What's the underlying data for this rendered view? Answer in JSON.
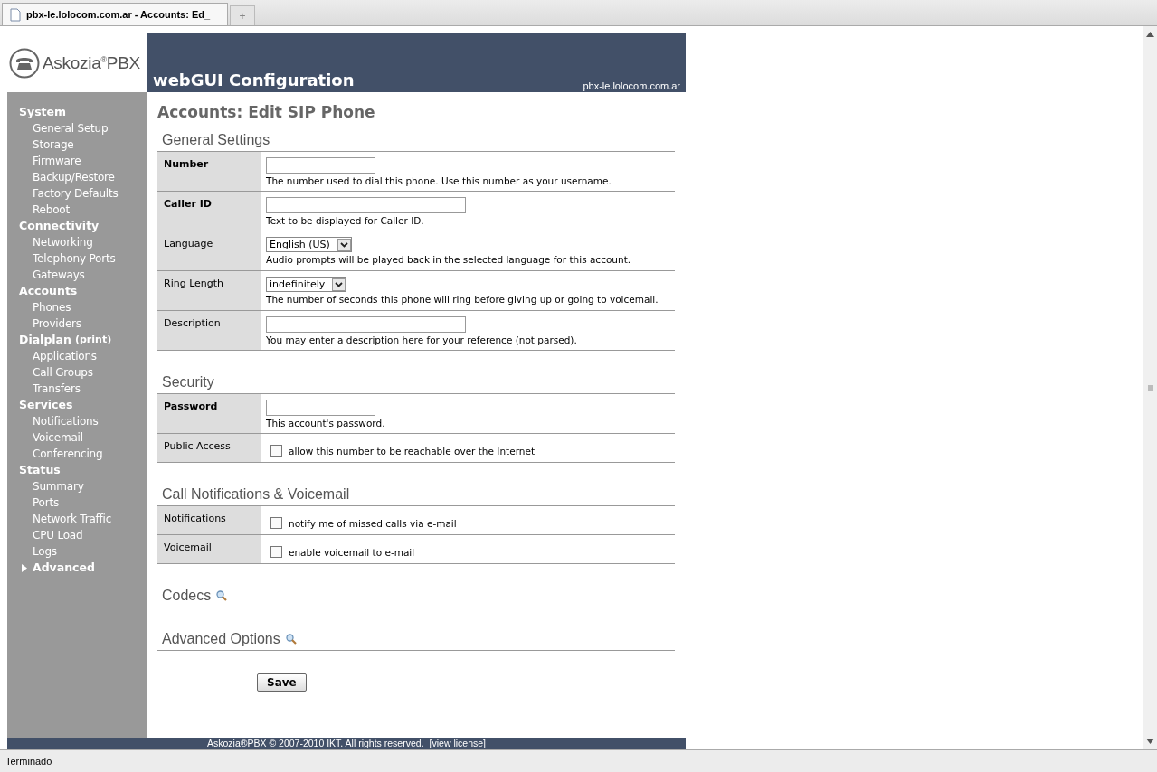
{
  "browser": {
    "tab_title": "pbx-le.lolocom.com.ar - Accounts: Ed_",
    "new_tab": "+",
    "status_text": "Terminado"
  },
  "header": {
    "logo_name": "Askozia",
    "logo_mark": "®",
    "logo_suffix": "PBX",
    "title": "webGUI Configuration",
    "host": "pbx-le.lolocom.com.ar"
  },
  "sidebar": [
    {
      "label": "System",
      "items": [
        "General Setup",
        "Storage",
        "Firmware",
        "Backup/Restore",
        "Factory Defaults",
        "Reboot"
      ]
    },
    {
      "label": "Connectivity",
      "items": [
        "Networking",
        "Telephony Ports",
        "Gateways"
      ]
    },
    {
      "label": "Accounts",
      "items": [
        "Phones",
        "Providers"
      ]
    },
    {
      "label": "Dialplan",
      "link": "(print)",
      "items": [
        "Applications",
        "Call Groups",
        "Transfers"
      ]
    },
    {
      "label": "Services",
      "items": [
        "Notifications",
        "Voicemail",
        "Conferencing"
      ]
    },
    {
      "label": "Status",
      "items": [
        "Summary",
        "Ports",
        "Network Traffic",
        "CPU Load",
        "Logs"
      ]
    },
    {
      "label": "Advanced",
      "kind": "collapsible",
      "expanded": false
    }
  ],
  "page_title": "Accounts: Edit SIP Phone",
  "sections": [
    {
      "title": "General Settings",
      "collapsed": false,
      "rows": [
        {
          "label": "Number",
          "required": true,
          "kind": "short-text",
          "hint": "The number used to dial this phone. Use this number as your username."
        },
        {
          "label": "Caller ID",
          "required": true,
          "kind": "text",
          "hint": "Text to be displayed for Caller ID."
        },
        {
          "label": "Language",
          "required": false,
          "kind": "select",
          "value": "English (US)",
          "hint": "Audio prompts will be played back in the selected language for this account."
        },
        {
          "label": "Ring Length",
          "required": false,
          "kind": "select",
          "value": "indefinitely",
          "hint": "The number of seconds this phone will ring before giving up or going to voicemail."
        },
        {
          "label": "Description",
          "required": false,
          "kind": "text",
          "hint": "You may enter a description here for your reference (not parsed)."
        }
      ]
    },
    {
      "title": "Security",
      "collapsed": false,
      "rows": [
        {
          "label": "Password",
          "required": true,
          "kind": "short-text",
          "hint": "This account's password."
        },
        {
          "label": "Public Access",
          "required": false,
          "kind": "checkbox",
          "checked": false,
          "text": "allow this number to be reachable over the Internet"
        }
      ]
    },
    {
      "title": "Call Notifications & Voicemail",
      "collapsed": false,
      "rows": [
        {
          "label": "Notifications",
          "required": false,
          "kind": "checkbox",
          "checked": false,
          "text": "notify me of missed calls via e-mail"
        },
        {
          "label": "Voicemail",
          "required": false,
          "kind": "checkbox",
          "checked": false,
          "text": "enable voicemail to e-mail"
        }
      ]
    },
    {
      "title": "Codecs",
      "collapsed": true
    },
    {
      "title": "Advanced Options",
      "collapsed": true
    }
  ],
  "save_button": "Save",
  "footer": {
    "text": "Askozia®PBX © 2007-2010 IKT. All rights reserved.",
    "link": "[view license]"
  }
}
